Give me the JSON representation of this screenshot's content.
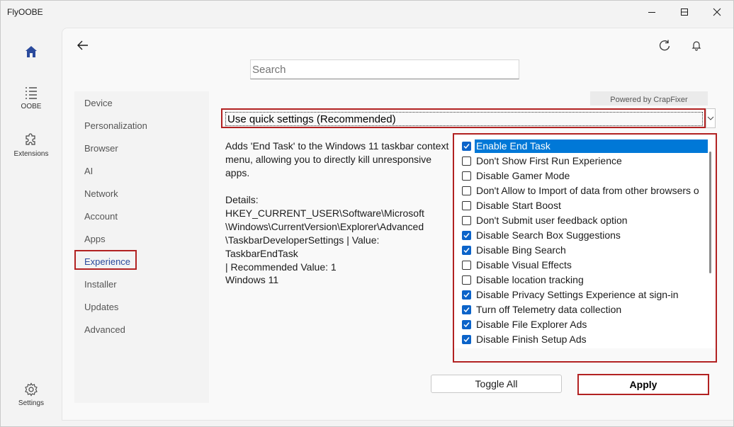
{
  "window": {
    "title": "FlyOOBE"
  },
  "rail": {
    "items": [
      {
        "label": "",
        "icon": "home-icon"
      },
      {
        "label": "OOBE",
        "icon": "list-icon"
      },
      {
        "label": "Extensions",
        "icon": "puzzle-icon"
      }
    ],
    "settings_label": "Settings"
  },
  "search": {
    "placeholder": "Search"
  },
  "nav": {
    "items": [
      "Device",
      "Personalization",
      "Browser",
      "AI",
      "Network",
      "Account",
      "Apps",
      "Experience",
      "Installer",
      "Updates",
      "Advanced"
    ],
    "active": "Experience"
  },
  "powered_by": "Powered by CrapFixer",
  "dropdown": {
    "selected": "Use quick settings (Recommended)"
  },
  "description": {
    "text": "Adds 'End Task' to the Windows 11 taskbar context menu, allowing you to directly kill unresponsive apps.\n\nDetails:\nHKEY_CURRENT_USER\\Software\\Microsoft\n\\Windows\\CurrentVersion\\Explorer\\Advanced\n\\TaskbarDeveloperSettings | Value: TaskbarEndTask\n| Recommended Value: 1",
    "os": "Windows 11"
  },
  "options": [
    {
      "label": "Enable End Task",
      "checked": true,
      "selected": true
    },
    {
      "label": "Don't Show First Run Experience",
      "checked": false
    },
    {
      "label": "Disable Gamer Mode",
      "checked": false
    },
    {
      "label": "Don't Allow to Import of data from other browsers o",
      "checked": false
    },
    {
      "label": "Disable Start Boost",
      "checked": false
    },
    {
      "label": "Don't Submit user feedback option",
      "checked": false
    },
    {
      "label": "Disable Search Box Suggestions",
      "checked": true
    },
    {
      "label": "Disable Bing Search",
      "checked": true
    },
    {
      "label": "Disable Visual Effects",
      "checked": false
    },
    {
      "label": "Disable location tracking",
      "checked": false
    },
    {
      "label": "Disable Privacy Settings Experience at sign-in",
      "checked": true
    },
    {
      "label": "Turn off Telemetry data collection",
      "checked": true
    },
    {
      "label": "Disable File Explorer Ads",
      "checked": true
    },
    {
      "label": "Disable Finish Setup Ads",
      "checked": true
    }
  ],
  "buttons": {
    "toggle_all": "Toggle All",
    "apply": "Apply"
  },
  "colors": {
    "highlight_border": "#b22222",
    "selection": "#0078d7",
    "checkbox": "#0b63c9",
    "home_accent": "#2a4a9c"
  }
}
